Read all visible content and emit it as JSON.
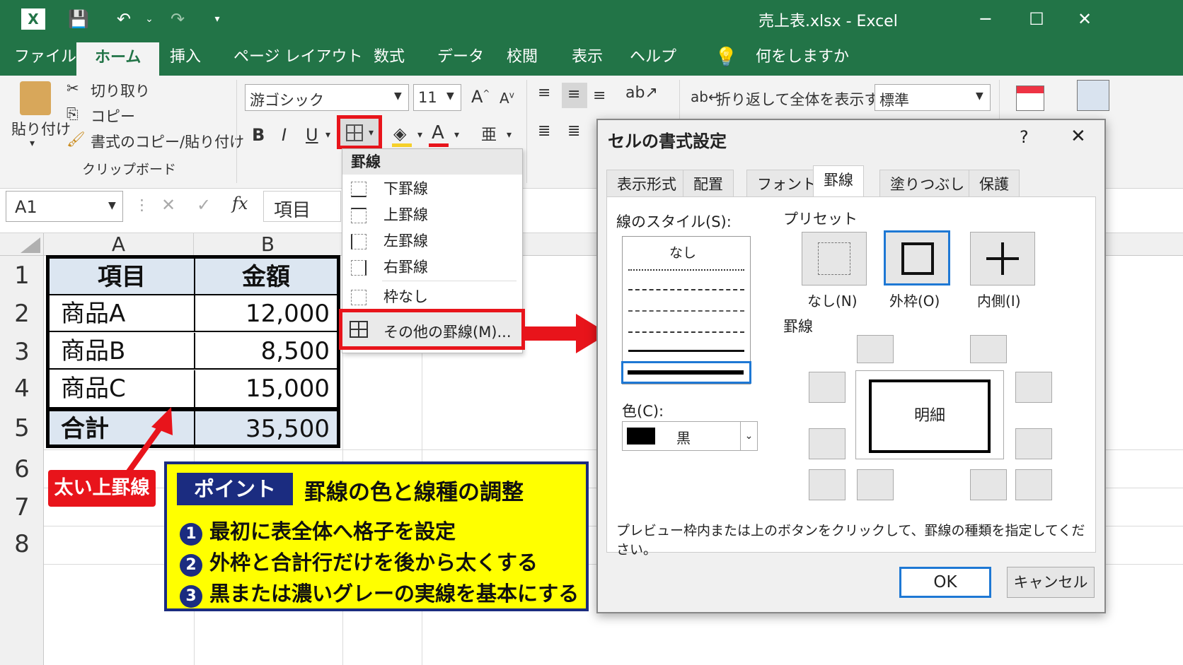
{
  "titlebar": {
    "doc_title": "売上表.xlsx  -  Excel",
    "bg": "#227447"
  },
  "tabs": [
    {
      "label": "ファイル"
    },
    {
      "label": "ホーム"
    },
    {
      "label": "挿入"
    },
    {
      "label": "ページ レイアウト"
    },
    {
      "label": "数式"
    },
    {
      "label": "データ"
    },
    {
      "label": "校閲"
    },
    {
      "label": "表示"
    },
    {
      "label": "ヘルプ"
    }
  ],
  "tellme": "何をしますか",
  "ribbon": {
    "paste": "貼り付け",
    "cut": "切り取り",
    "copy": "コピー",
    "format_painter": "書式のコピー/貼り付け",
    "clipboard_group": "クリップボード",
    "font_name": "游ゴシック",
    "font_size": "11",
    "bold": "B",
    "italic": "I",
    "underline": "U",
    "wrap_text": "折り返して全体を表示する",
    "number_format": "標準"
  },
  "formula_bar": {
    "name_box": "A1",
    "fx": "fx",
    "content": "項目"
  },
  "columns": [
    "A",
    "B"
  ],
  "rows": [
    "1",
    "2",
    "3",
    "4",
    "5",
    "6",
    "7",
    "8"
  ],
  "table": {
    "header": [
      "項目",
      "金額"
    ],
    "rows": [
      [
        "商品A",
        "12,000"
      ],
      [
        "商品B",
        "8,500"
      ],
      [
        "商品C",
        "15,000"
      ]
    ],
    "total": [
      "合計",
      "35,500"
    ]
  },
  "border_menu": {
    "header": "罫線",
    "items": [
      "下罫線",
      "上罫線",
      "左罫線",
      "右罫線",
      "枠なし"
    ],
    "more": "その他の罫線(M)..."
  },
  "annotation_label": "太い上罫線",
  "callout": {
    "badge": "ポイント",
    "title": "罫線の色と線種の調整",
    "points": [
      {
        "n": "1",
        "text": "最初に表全体へ格子を設定"
      },
      {
        "n": "2",
        "text": "外枠と合計行だけを後から太くする"
      },
      {
        "n": "3",
        "text": "黒または濃いグレーの実線を基本にする"
      }
    ]
  },
  "dialog": {
    "title": "セルの書式設定",
    "help": "?",
    "close": "✕",
    "tabs": [
      "表示形式",
      "配置",
      "フォント",
      "罫線",
      "塗りつぶし",
      "保護"
    ],
    "active_tab": "罫線",
    "line_style_label": "線のスタイル(S):",
    "line_style_none": "なし",
    "color_label": "色(C):",
    "color_value": "黒",
    "preset_label": "プリセット",
    "preset_none": "なし(N)",
    "preset_outline": "外枠(O)",
    "preset_inside": "内側(I)",
    "border_label": "罫線",
    "preview_text": "明細",
    "hint": "プレビュー枠内または上のボタンをクリックして、罫線の種類を指定してください。",
    "ok": "OK",
    "cancel": "キャンセル"
  },
  "colors": {
    "excel_green": "#227447",
    "highlight_red": "#e8141b",
    "callout_yellow": "#ffff00",
    "callout_navy": "#1b2c80",
    "header_fill": "#dce6f1"
  }
}
